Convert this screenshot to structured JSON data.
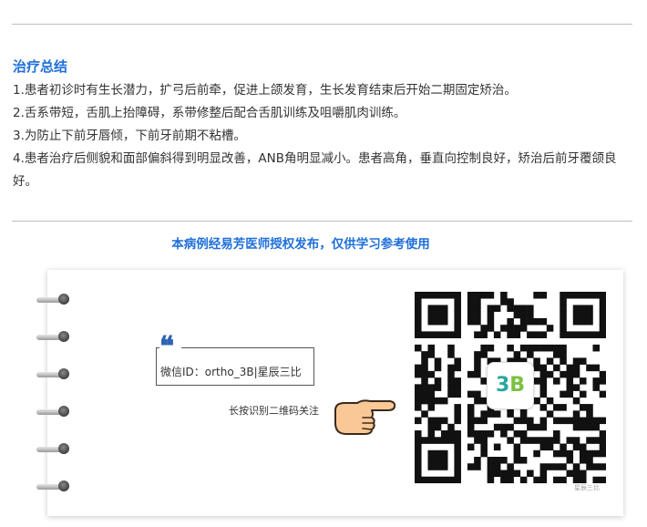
{
  "summary": {
    "title": "治疗总结",
    "items": [
      "1.患者初诊时有生长潜力，扩弓后前牵，促进上颌发育，生长发育结束后开始二期固定矫治。",
      "2.舌系带短，舌肌上抬障碍，系带修整后配合舌肌训练及咀嚼肌肉训练。",
      "3.为防止下前牙唇倾，下前牙前期不粘槽。",
      "4.患者治疗后侧貌和面部偏斜得到明显改善，ANB角明显减小。患者高角，垂直向控制良好，矫治后前牙覆颌良好。"
    ]
  },
  "authorization_note": "本病例经易芳医师授权发布，仅供学习参考使用",
  "card": {
    "quote_mark": "❝",
    "wechat_id": "微信ID：ortho_3B|星辰三比",
    "long_press_text": "长按识别二维码关注",
    "qr_logo_text_left": "3",
    "qr_logo_text_right": "B",
    "watermark": "星辰三比"
  },
  "colors": {
    "accent": "#1e6fd9",
    "text": "#333333",
    "quote": "#2f63b3"
  },
  "icons": [
    "pointing-hand-icon",
    "qr-code-icon",
    "quote-icon",
    "binder-ring-icon"
  ]
}
